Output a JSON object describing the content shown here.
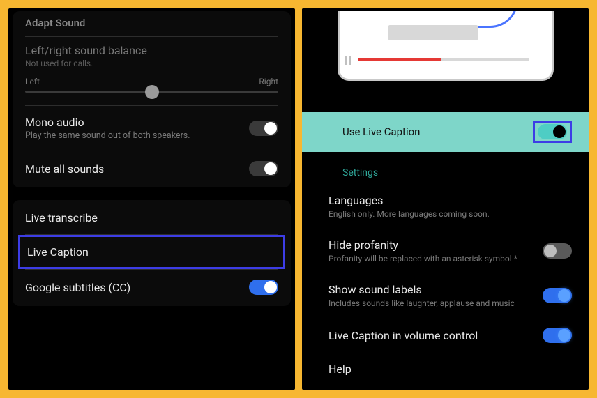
{
  "left": {
    "truncated_header": "Adapt Sound",
    "balance": {
      "title": "Left/right sound balance",
      "sub": "Not used for calls.",
      "left_label": "Left",
      "right_label": "Right"
    },
    "mono": {
      "title": "Mono audio",
      "sub": "Play the same sound out of both speakers."
    },
    "mute": {
      "title": "Mute all sounds"
    },
    "transcribe": {
      "title": "Live transcribe"
    },
    "caption": {
      "title": "Live Caption"
    },
    "subtitles": {
      "title": "Google subtitles (CC)"
    }
  },
  "right": {
    "use_live": "Use Live Caption",
    "settings_label": "Settings",
    "languages": {
      "title": "Languages",
      "sub": "English only. More languages coming soon."
    },
    "profanity": {
      "title": "Hide profanity",
      "sub": "Profanity will be replaced with an asterisk symbol *"
    },
    "sound_labels": {
      "title": "Show sound labels",
      "sub": "Includes sounds like laughter, applause and music"
    },
    "volume_ctrl": {
      "title": "Live Caption in volume control"
    },
    "help": {
      "title": "Help"
    }
  }
}
